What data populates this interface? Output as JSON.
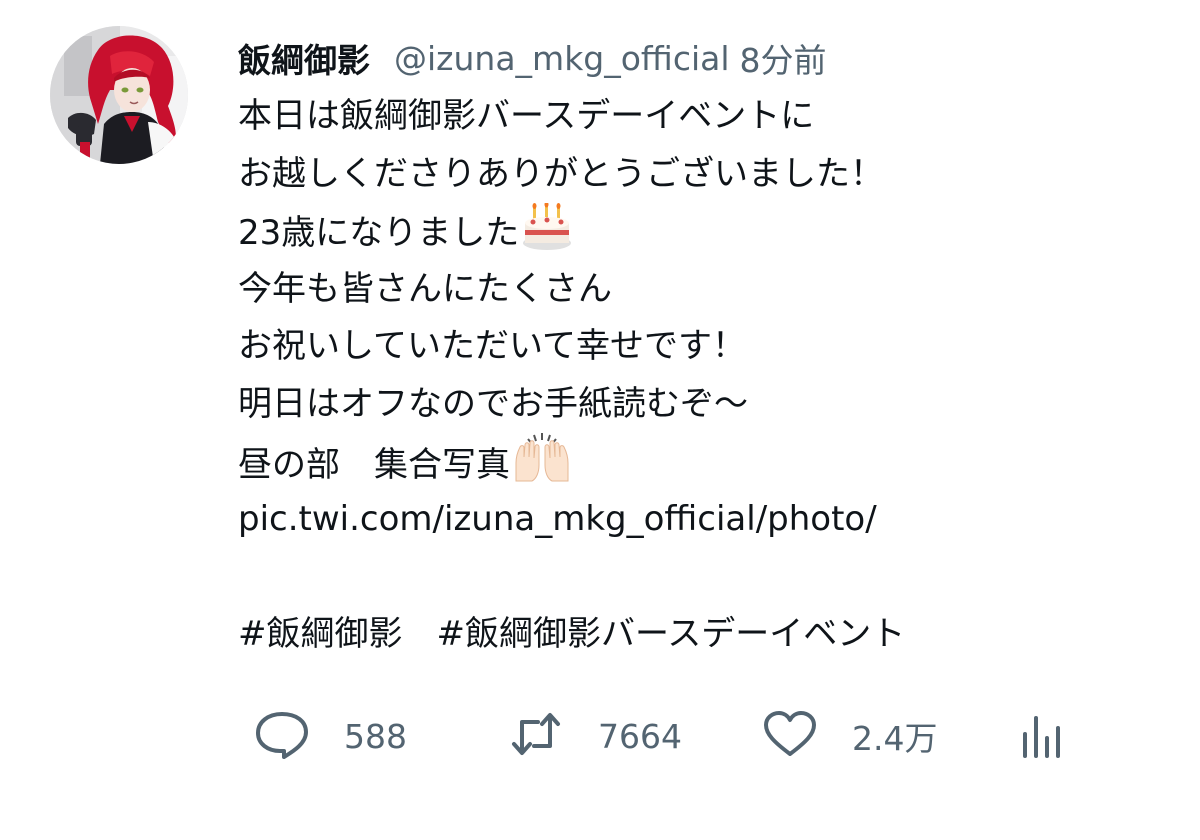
{
  "tweet": {
    "display_name": "飯綱御影",
    "handle": "@izuna_mkg_official",
    "time": "8分前",
    "lines": {
      "l1": "本日は飯綱御影バースデーイベントに",
      "l2": "お越しくださりありがとうございました！",
      "l3": "23歳になりました",
      "l4": "今年も皆さんにたくさん",
      "l5": "お祝いしていただいて幸せです！",
      "l6": "明日はオフなのでお手紙読むぞ〜",
      "l7": "昼の部　集合写真",
      "link": "pic.twi.com/izuna_mkg_official/photo/"
    },
    "hashtags": {
      "tag1": "#飯綱御影",
      "tag2": "#飯綱御影バースデーイベント"
    },
    "emojis": {
      "l3": "birthday-cake-icon",
      "l7": "raising-hands-icon"
    }
  },
  "actions": {
    "reply_count": "588",
    "retweet_count": "7664",
    "like_count": "2.4万",
    "icons": {
      "reply": "speech-bubble-icon",
      "retweet": "retweet-arrows-icon",
      "like": "heart-icon",
      "views": "bar-chart-icon"
    }
  },
  "colors": {
    "text": "#0f1419",
    "secondary": "#536471",
    "background": "#ffffff",
    "avatar_hair": "#c8102e"
  }
}
